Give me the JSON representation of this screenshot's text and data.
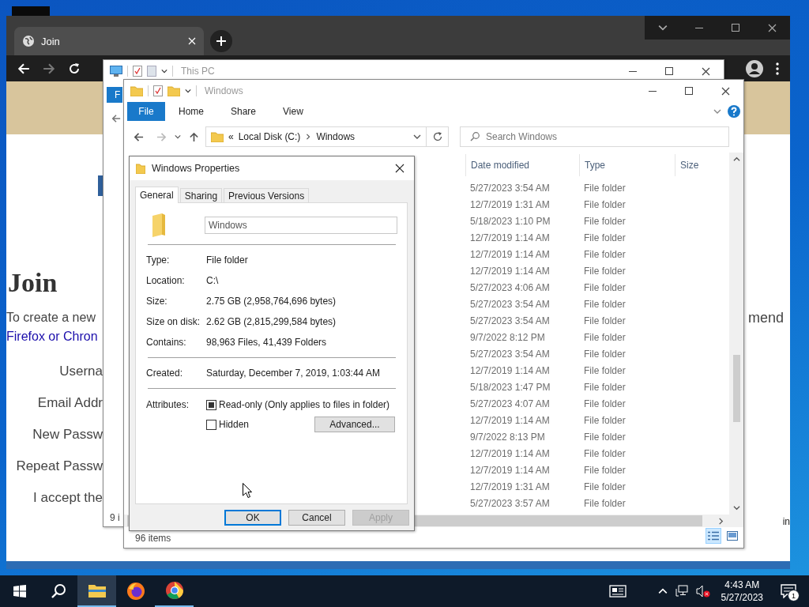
{
  "browser": {
    "tab": {
      "title": "Join"
    },
    "page": {
      "heading": "Join",
      "intro": "To create a new",
      "intro_end": "mend",
      "link": "Firefox or Chron",
      "labels": [
        "Userna",
        "Email Addr",
        "New Passw",
        "Repeat Passw",
        "I accept the"
      ],
      "corner_text": "in"
    }
  },
  "this_pc_window": {
    "title": "This PC",
    "ribbon_tab": "F",
    "status": "9 i"
  },
  "explorer": {
    "title": "Windows",
    "ribbon_tabs": [
      {
        "label": "File",
        "kind": "menu"
      },
      {
        "label": "Home",
        "kind": "tab"
      },
      {
        "label": "Share",
        "kind": "tab"
      },
      {
        "label": "View",
        "kind": "tab"
      }
    ],
    "address": {
      "overflow": "«",
      "crumbs": [
        "Local Disk (C:)",
        "Windows"
      ]
    },
    "search": {
      "placeholder": "Search Windows"
    },
    "columns": [
      "Date modified",
      "Type",
      "Size"
    ],
    "rows": [
      {
        "date": "5/27/2023 3:54 AM",
        "type": "File folder"
      },
      {
        "date": "12/7/2019 1:31 AM",
        "type": "File folder"
      },
      {
        "date": "5/18/2023 1:10 PM",
        "type": "File folder"
      },
      {
        "date": "12/7/2019 1:14 AM",
        "type": "File folder"
      },
      {
        "date": "12/7/2019 1:14 AM",
        "type": "File folder"
      },
      {
        "date": "12/7/2019 1:14 AM",
        "type": "File folder"
      },
      {
        "date": "5/27/2023 4:06 AM",
        "type": "File folder"
      },
      {
        "date": "5/27/2023 3:54 AM",
        "type": "File folder"
      },
      {
        "date": "5/27/2023 3:54 AM",
        "type": "File folder"
      },
      {
        "date": "9/7/2022 8:12 PM",
        "type": "File folder"
      },
      {
        "date": "5/27/2023 3:54 AM",
        "type": "File folder"
      },
      {
        "date": "12/7/2019 1:14 AM",
        "type": "File folder"
      },
      {
        "date": "5/18/2023 1:47 PM",
        "type": "File folder"
      },
      {
        "date": "5/27/2023 4:07 AM",
        "type": "File folder"
      },
      {
        "date": "12/7/2019 1:14 AM",
        "type": "File folder"
      },
      {
        "date": "9/7/2022 8:13 PM",
        "type": "File folder"
      },
      {
        "date": "12/7/2019 1:14 AM",
        "type": "File folder"
      },
      {
        "date": "12/7/2019 1:14 AM",
        "type": "File folder"
      },
      {
        "date": "12/7/2019 1:31 AM",
        "type": "File folder"
      },
      {
        "date": "5/27/2023 3:57 AM",
        "type": "File folder"
      }
    ],
    "status": "96 items"
  },
  "dialog": {
    "title": "Windows Properties",
    "tabs": [
      {
        "label": "General",
        "selected": true
      },
      {
        "label": "Sharing",
        "selected": false
      },
      {
        "label": "Previous Versions",
        "selected": false
      }
    ],
    "name_field": {
      "value": "Windows"
    },
    "sections": [
      [
        {
          "label": "Type:",
          "value": "File folder"
        },
        {
          "label": "Location:",
          "value": "C:\\"
        },
        {
          "label": "Size:",
          "value": "2.75 GB (2,958,764,696 bytes)"
        },
        {
          "label": "Size on disk:",
          "value": "2.62 GB (2,815,299,584 bytes)"
        },
        {
          "label": "Contains:",
          "value": "98,963 Files, 41,439 Folders"
        }
      ],
      [
        {
          "label": "Created:",
          "value": "Saturday, December 7, 2019, 1:03:44 AM"
        }
      ]
    ],
    "attributes": {
      "label": "Attributes:",
      "items": [
        {
          "label": "Read-only (Only applies to files in folder)",
          "checked": true
        },
        {
          "label": "Hidden",
          "checked": false
        }
      ],
      "advanced_button": "Advanced..."
    },
    "buttons": [
      {
        "label": "OK",
        "default": true,
        "disabled": false
      },
      {
        "label": "Cancel",
        "default": false,
        "disabled": false
      },
      {
        "label": "Apply",
        "default": false,
        "disabled": true
      }
    ]
  },
  "taskbar": {
    "apps": [
      {
        "kind": "explorer",
        "active": true,
        "running": true
      },
      {
        "kind": "firefox",
        "active": false,
        "running": false
      },
      {
        "kind": "chrome",
        "active": false,
        "running": true
      }
    ],
    "clock": {
      "time": "4:43 AM",
      "date": "5/27/2023"
    },
    "notifications": {
      "count": "1"
    }
  }
}
